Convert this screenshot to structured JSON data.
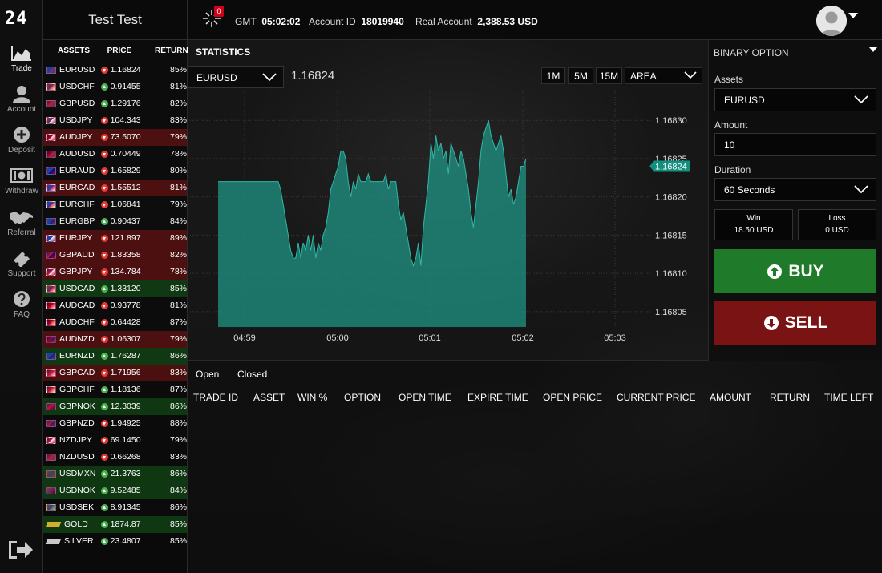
{
  "brand": {
    "logo_text": "24"
  },
  "nav": [
    {
      "key": "trade",
      "label": "Trade",
      "icon": "area-chart-icon",
      "active": true
    },
    {
      "key": "account",
      "label": "Account",
      "icon": "user-icon",
      "active": false
    },
    {
      "key": "deposit",
      "label": "Deposit",
      "icon": "plus-circle-icon",
      "active": false
    },
    {
      "key": "withdraw",
      "label": "Withdraw",
      "icon": "money-icon",
      "active": false
    },
    {
      "key": "referral",
      "label": "Referral",
      "icon": "handshake-icon",
      "active": false
    },
    {
      "key": "support",
      "label": "Support",
      "icon": "ticket-icon",
      "active": false
    },
    {
      "key": "faq",
      "label": "FAQ",
      "icon": "question-circle-icon",
      "active": false
    }
  ],
  "header": {
    "user_name": "Test Test",
    "notification_count": "0",
    "gmt_label": "GMT",
    "gmt_time": "05:02:02",
    "account_id_label": "Account ID",
    "account_id": "18019940",
    "account_type_label": "Real Account",
    "balance": "2,388.53 USD"
  },
  "assets": {
    "headers": {
      "asset": "ASSETS",
      "price": "PRICE",
      "return": "RETURN"
    },
    "rows": [
      {
        "name": "EURUSD",
        "price": "1.16824",
        "dir": "down",
        "ret": "85%",
        "hl": "none"
      },
      {
        "name": "USDCHF",
        "price": "0.91455",
        "dir": "up",
        "ret": "81%",
        "hl": "none"
      },
      {
        "name": "GBPUSD",
        "price": "1.29176",
        "dir": "up",
        "ret": "82%",
        "hl": "none"
      },
      {
        "name": "USDJPY",
        "price": "104.343",
        "dir": "down",
        "ret": "83%",
        "hl": "none"
      },
      {
        "name": "AUDJPY",
        "price": "73.5070",
        "dir": "down",
        "ret": "79%",
        "hl": "red"
      },
      {
        "name": "AUDUSD",
        "price": "0.70449",
        "dir": "down",
        "ret": "78%",
        "hl": "none"
      },
      {
        "name": "EURAUD",
        "price": "1.65829",
        "dir": "down",
        "ret": "80%",
        "hl": "none"
      },
      {
        "name": "EURCAD",
        "price": "1.55512",
        "dir": "down",
        "ret": "81%",
        "hl": "red"
      },
      {
        "name": "EURCHF",
        "price": "1.06841",
        "dir": "down",
        "ret": "79%",
        "hl": "none"
      },
      {
        "name": "EURGBP",
        "price": "0.90437",
        "dir": "up",
        "ret": "84%",
        "hl": "none"
      },
      {
        "name": "EURJPY",
        "price": "121.897",
        "dir": "down",
        "ret": "89%",
        "hl": "red"
      },
      {
        "name": "GBPAUD",
        "price": "1.83358",
        "dir": "down",
        "ret": "82%",
        "hl": "red"
      },
      {
        "name": "GBPJPY",
        "price": "134.784",
        "dir": "down",
        "ret": "78%",
        "hl": "red"
      },
      {
        "name": "USDCAD",
        "price": "1.33120",
        "dir": "up",
        "ret": "85%",
        "hl": "green"
      },
      {
        "name": "AUDCAD",
        "price": "0.93778",
        "dir": "down",
        "ret": "81%",
        "hl": "none"
      },
      {
        "name": "AUDCHF",
        "price": "0.64428",
        "dir": "down",
        "ret": "87%",
        "hl": "none"
      },
      {
        "name": "AUDNZD",
        "price": "1.06307",
        "dir": "down",
        "ret": "79%",
        "hl": "red"
      },
      {
        "name": "EURNZD",
        "price": "1.76287",
        "dir": "up",
        "ret": "86%",
        "hl": "green"
      },
      {
        "name": "GBPCAD",
        "price": "1.71956",
        "dir": "down",
        "ret": "83%",
        "hl": "red"
      },
      {
        "name": "GBPCHF",
        "price": "1.18136",
        "dir": "up",
        "ret": "87%",
        "hl": "none"
      },
      {
        "name": "GBPNOK",
        "price": "12.3039",
        "dir": "up",
        "ret": "86%",
        "hl": "green"
      },
      {
        "name": "GBPNZD",
        "price": "1.94925",
        "dir": "down",
        "ret": "88%",
        "hl": "none"
      },
      {
        "name": "NZDJPY",
        "price": "69.1450",
        "dir": "down",
        "ret": "79%",
        "hl": "none"
      },
      {
        "name": "NZDUSD",
        "price": "0.66268",
        "dir": "down",
        "ret": "83%",
        "hl": "none"
      },
      {
        "name": "USDMXN",
        "price": "21.3763",
        "dir": "up",
        "ret": "86%",
        "hl": "green"
      },
      {
        "name": "USDNOK",
        "price": "9.52485",
        "dir": "up",
        "ret": "84%",
        "hl": "green"
      },
      {
        "name": "USDSEK",
        "price": "8.91345",
        "dir": "up",
        "ret": "86%",
        "hl": "none"
      },
      {
        "name": "GOLD",
        "price": "1874.87",
        "dir": "up",
        "ret": "85%",
        "hl": "green"
      },
      {
        "name": "SILVER",
        "price": "23.4807",
        "dir": "up",
        "ret": "85%",
        "hl": "none"
      }
    ]
  },
  "stats": {
    "title": "STATISTICS",
    "symbol": "EURUSD",
    "price": "1.16824",
    "timeframes": [
      "1M",
      "5M",
      "15M"
    ],
    "chart_type": "AREA"
  },
  "chart_data": {
    "type": "area",
    "series_color": "#1f8f82",
    "ylim": [
      1.16803,
      1.16834
    ],
    "y_ticks": [
      "1.16830",
      "1.16825",
      "1.16820",
      "1.16815",
      "1.16810",
      "1.16805"
    ],
    "x_ticks": [
      "04:59",
      "05:00",
      "05:01",
      "05:02",
      "05:03"
    ],
    "current_marker": "1.16824",
    "values": [
      1.16822,
      1.16822,
      1.16822,
      1.16822,
      1.16822,
      1.16822,
      1.16822,
      1.16822,
      1.16822,
      1.16822,
      1.16822,
      1.16822,
      1.16822,
      1.16822,
      1.16822,
      1.16822,
      1.16822,
      1.16822,
      1.16822,
      1.16822,
      1.16822,
      1.16822,
      1.16822,
      1.16822,
      1.16822,
      1.16821,
      1.16819,
      1.16817,
      1.16815,
      1.16813,
      1.16812,
      1.16812,
      1.16814,
      1.16812,
      1.16814,
      1.16813,
      1.16815,
      1.16813,
      1.16815,
      1.16812,
      1.16814,
      1.16813,
      1.16815,
      1.16816,
      1.16818,
      1.16821,
      1.16822,
      1.16823,
      1.16824,
      1.16826,
      1.16826,
      1.16825,
      1.16822,
      1.1682,
      1.16822,
      1.16821,
      1.16823,
      1.16822,
      1.16822,
      1.16822,
      1.16823,
      1.16822,
      1.16822,
      1.16822,
      1.16822,
      1.16822,
      1.16822,
      1.16823,
      1.16821,
      1.16822,
      1.16822,
      1.16822,
      1.16819,
      1.16817,
      1.16818,
      1.16816,
      1.16814,
      1.16812,
      1.16811,
      1.16812,
      1.16814,
      1.16811,
      1.16816,
      1.16819,
      1.16822,
      1.16827,
      1.16825,
      1.16828,
      1.16826,
      1.16827,
      1.16825,
      1.16826,
      1.16823,
      1.16827,
      1.16826,
      1.16825,
      1.16824,
      1.16826,
      1.16825,
      1.16823,
      1.16821,
      1.16818,
      1.16816,
      1.16819,
      1.16822,
      1.16826,
      1.16828,
      1.16829,
      1.1683,
      1.16828,
      1.16827,
      1.16826,
      1.16827,
      1.16828,
      1.16826,
      1.16823,
      1.1682,
      1.16821,
      1.16819,
      1.1682,
      1.16822,
      1.16824,
      1.16824,
      1.16825
    ]
  },
  "order": {
    "title": "BINARY OPTION",
    "assets_label": "Assets",
    "asset_value": "EURUSD",
    "amount_label": "Amount",
    "amount_value": "10",
    "duration_label": "Duration",
    "duration_value": "60 Seconds",
    "win_label": "Win",
    "win_value": "18.50 USD",
    "loss_label": "Loss",
    "loss_value": "0 USD",
    "buy_label": "BUY",
    "sell_label": "SELL"
  },
  "trades": {
    "tabs": [
      "Open",
      "Closed"
    ],
    "columns": [
      "TRADE ID",
      "ASSET",
      "WIN %",
      "OPTION",
      "OPEN TIME",
      "EXPIRE TIME",
      "OPEN PRICE",
      "CURRENT PRICE",
      "AMOUNT",
      "RETURN",
      "TIME LEFT"
    ]
  }
}
